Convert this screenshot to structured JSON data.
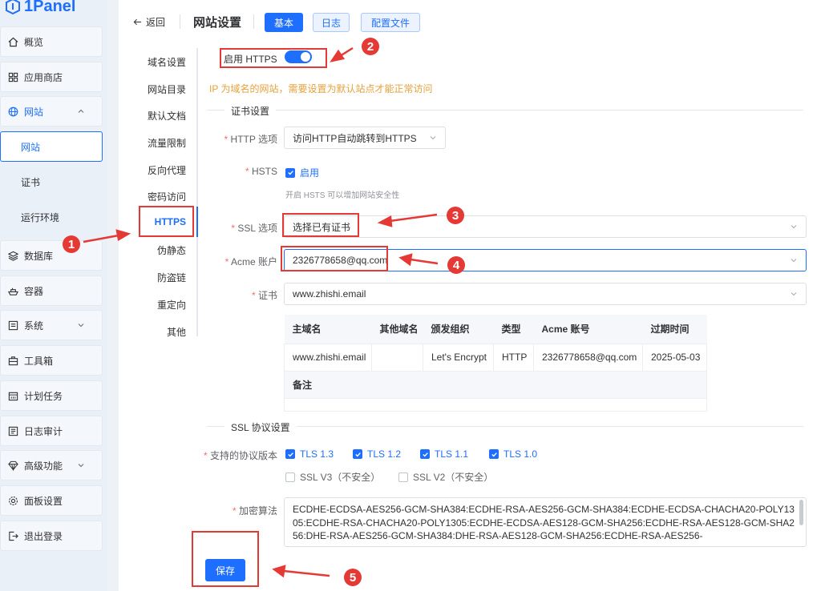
{
  "app": {
    "logo_text": "1Panel"
  },
  "sidebar": {
    "items": [
      {
        "label": "概览",
        "icon": "home-icon"
      },
      {
        "label": "应用商店",
        "icon": "grid-icon"
      },
      {
        "label": "网站",
        "icon": "globe-icon"
      },
      {
        "label": "网站"
      },
      {
        "label": "证书"
      },
      {
        "label": "运行环境"
      },
      {
        "label": "数据库",
        "icon": "layers-icon"
      },
      {
        "label": "容器",
        "icon": "ship-icon"
      },
      {
        "label": "系统",
        "icon": "monitor-icon"
      },
      {
        "label": "工具箱",
        "icon": "toolbox-icon"
      },
      {
        "label": "计划任务",
        "icon": "calendar-icon"
      },
      {
        "label": "日志审计",
        "icon": "log-icon"
      },
      {
        "label": "高级功能",
        "icon": "diamond-icon"
      },
      {
        "label": "面板设置",
        "icon": "gear-icon"
      },
      {
        "label": "退出登录",
        "icon": "logout-icon"
      }
    ]
  },
  "header": {
    "back_label": "返回",
    "title": "网站设置",
    "tabs": [
      "基本",
      "日志",
      "配置文件"
    ]
  },
  "subnav": [
    "域名设置",
    "网站目录",
    "默认文档",
    "流量限制",
    "反向代理",
    "密码访问",
    "HTTPS",
    "伪静态",
    "防盗链",
    "重定向",
    "其他"
  ],
  "form": {
    "enable_https_label": "启用 HTTPS",
    "ip_warning": "IP 为域名的网站，需要设置为默认站点才能正常访问",
    "cert_section": "证书设置",
    "http_option_label": "HTTP 选项",
    "http_option_value": "访问HTTP自动跳转到HTTPS",
    "hsts_label": "HSTS",
    "hsts_checkbox": "启用",
    "hsts_hint": "开启 HSTS 可以增加网站安全性",
    "ssl_option_label": "SSL 选项",
    "ssl_option_value": "选择已有证书",
    "acme_label": "Acme 账户",
    "acme_value": "2326778658@qq.com",
    "cert_label": "证书",
    "cert_value": "www.zhishi.email",
    "ssl_section": "SSL 协议设置",
    "protocol_label": "支持的协议版本",
    "protocols_checked": [
      "TLS 1.3",
      "TLS 1.2",
      "TLS 1.1",
      "TLS 1.0"
    ],
    "protocols_unchecked": [
      "SSL V3（不安全）",
      "SSL V2（不安全）"
    ],
    "cipher_label": "加密算法",
    "cipher_value": "ECDHE-ECDSA-AES256-GCM-SHA384:ECDHE-RSA-AES256-GCM-SHA384:ECDHE-ECDSA-CHACHA20-POLY1305:ECDHE-RSA-CHACHA20-POLY1305:ECDHE-ECDSA-AES128-GCM-SHA256:ECDHE-RSA-AES128-GCM-SHA256:DHE-RSA-AES256-GCM-SHA384:DHE-RSA-AES128-GCM-SHA256:ECDHE-RSA-AES256-",
    "save_label": "保存"
  },
  "cert_table": {
    "headers": [
      "主域名",
      "其他域名",
      "颁发组织",
      "类型",
      "Acme 账号",
      "过期时间"
    ],
    "row": [
      "www.zhishi.email",
      "",
      "Let's Encrypt",
      "HTTP",
      "2326778658@qq.com",
      "2025-05-03"
    ],
    "note_label": "备注"
  },
  "annotations": {
    "badges": [
      "1",
      "2",
      "3",
      "4",
      "5"
    ],
    "color": "#e53935"
  },
  "colors": {
    "primary": "#1e6fff",
    "warning": "#e6a23c",
    "annotation": "#e53935"
  }
}
